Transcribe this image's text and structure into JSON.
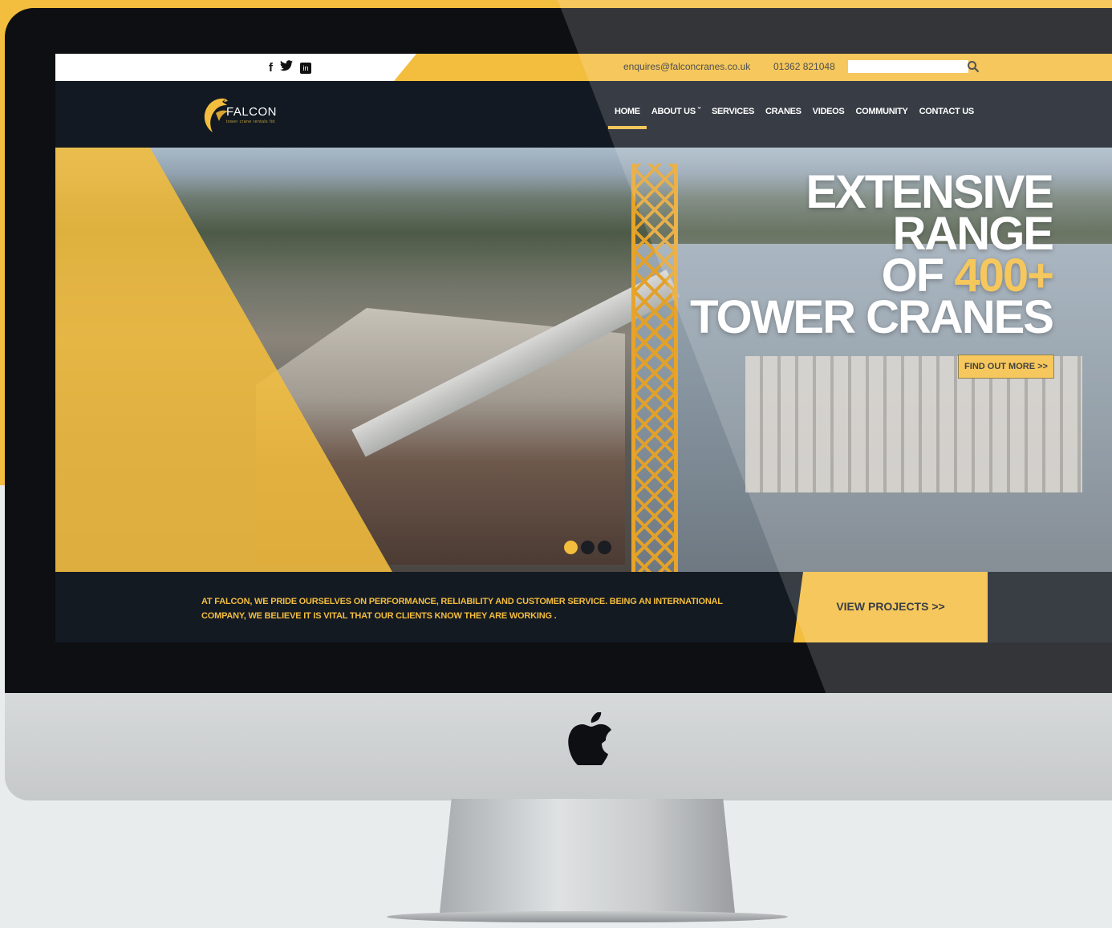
{
  "topbar": {
    "social": [
      {
        "name": "facebook",
        "glyph": "f"
      },
      {
        "name": "twitter",
        "glyph": "🐦"
      },
      {
        "name": "linkedin",
        "glyph": "in"
      }
    ],
    "email": "enquires@falconcranes.co.uk",
    "phone": "01362 821048",
    "search_placeholder": ""
  },
  "brand": {
    "name": "FALCON",
    "tagline": "tower crane rentals ltd"
  },
  "nav": {
    "items": [
      "HOME",
      "ABOUT US ˇ",
      "SERVICES",
      "CRANES",
      "VIDEOS",
      "COMMUNITY",
      "CONTACT US"
    ],
    "active_index": 0
  },
  "hero": {
    "line1": "EXTENSIVE",
    "line2": "RANGE",
    "line3_prefix": "OF ",
    "line3_accent": "400+",
    "line4": "TOWER CRANES",
    "cta": "FIND OUT MORE >>",
    "slides_total": 3,
    "slide_active": 1
  },
  "footer": {
    "text": "AT FALCON, WE PRIDE OURSELVES ON PERFORMANCE, RELIABILITY AND CUSTOMER SERVICE. BEING AN INTERNATIONAL COMPANY, WE BELIEVE IT IS VITAL THAT OUR CLIENTS KNOW THEY ARE WORKING .",
    "cta": "VIEW PROJECTS >>"
  },
  "colors": {
    "brand_yellow": "#f3bd3e",
    "navy": "#141a22",
    "background": "#e9ecec"
  }
}
